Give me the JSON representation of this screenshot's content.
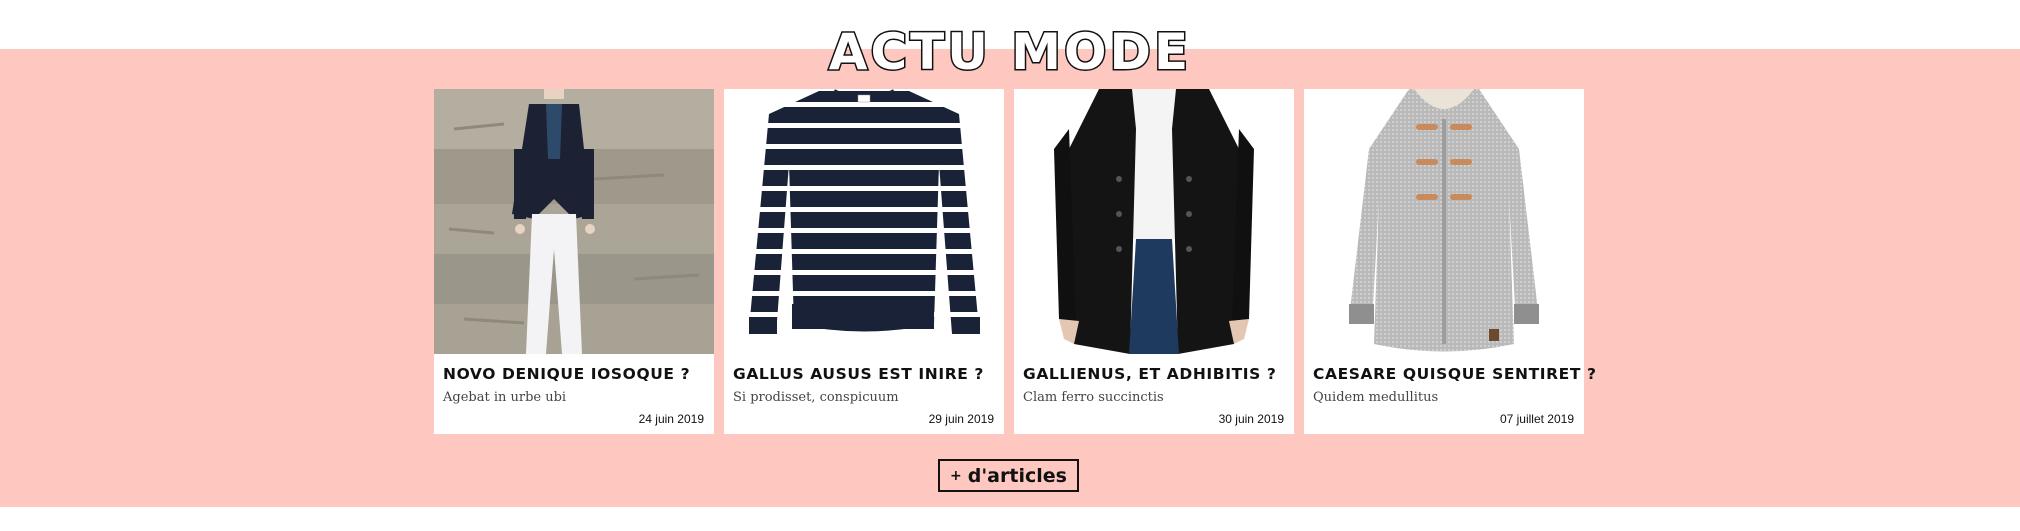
{
  "section": {
    "title": "ACTU MODE",
    "background_color": "#fec8c1"
  },
  "articles": [
    {
      "title": "NOVO DENIQUE IOSOQUE ?",
      "subtitle": "Agebat in urbe ubi",
      "date": "24 juin 2019",
      "image_icon": "denim-blazer-outfit-photo"
    },
    {
      "title": "GALLUS AUSUS EST INIRE ?",
      "subtitle": "Si prodisset, conspicuum",
      "date": "29 juin 2019",
      "image_icon": "striped-sweater-photo"
    },
    {
      "title": "GALLIENUS, ET ADHIBITIS ?",
      "subtitle": "Clam ferro succinctis",
      "date": "30 juin 2019",
      "image_icon": "black-peacoat-photo"
    },
    {
      "title": "CAESARE QUISQUE SENTIRET ?",
      "subtitle": "Quidem medullitus",
      "date": "07 juillet 2019",
      "image_icon": "grey-duffle-coat-photo"
    }
  ],
  "more_button": {
    "plus": "+",
    "label": "d'articles"
  }
}
